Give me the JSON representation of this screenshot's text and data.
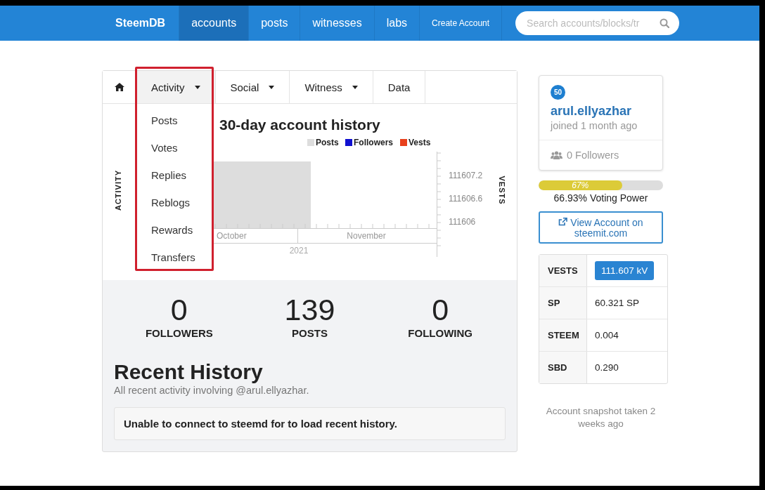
{
  "nav": {
    "brand": "SteemDB",
    "items": [
      {
        "label": "accounts",
        "kind": "link",
        "selected": true
      },
      {
        "label": "posts",
        "kind": "link",
        "selected": false
      },
      {
        "label": "witnesses",
        "kind": "link",
        "selected": false
      },
      {
        "label": "labs",
        "kind": "link",
        "selected": false
      },
      {
        "label": "Create Account",
        "kind": "small",
        "selected": false
      }
    ],
    "search": {
      "placeholder": "Search accounts/blocks/tr"
    }
  },
  "tabs": [
    {
      "kind": "home",
      "selected": false
    },
    {
      "kind": "dropdown",
      "label": "Activity",
      "selected": true
    },
    {
      "kind": "dropdown",
      "label": "Social",
      "selected": false
    },
    {
      "kind": "dropdown",
      "label": "Witness",
      "selected": false
    },
    {
      "kind": "plain",
      "label": "Data",
      "selected": false
    }
  ],
  "activity_menu": [
    "Posts",
    "Votes",
    "Replies",
    "Reblogs",
    "Rewards",
    "Transfers"
  ],
  "chart": {
    "title": "30-day account history",
    "legend": [
      {
        "label": "Posts",
        "color": "#dddddd"
      },
      {
        "label": "Followers",
        "color": "#1010d0"
      },
      {
        "label": "Vests",
        "color": "#e8401c"
      }
    ],
    "left_axis_label": "ACTIVITY",
    "right_axis_label": "VESTS",
    "right_ticks": [
      "111607.2",
      "111606.6",
      "111606"
    ],
    "x_labels": [
      "October",
      "November"
    ],
    "year_label": "2021"
  },
  "stats": [
    {
      "value": "0",
      "label": "FOLLOWERS"
    },
    {
      "value": "139",
      "label": "POSTS"
    },
    {
      "value": "0",
      "label": "FOLLOWING"
    }
  ],
  "recent": {
    "title": "Recent History",
    "subtitle": "All recent activity involving @arul.ellyazhar.",
    "notice": "Unable to connect to steemd for to load recent history."
  },
  "profile": {
    "reputation": "50",
    "name": "arul.ellyazhar",
    "joined": "joined 1 month ago",
    "followers": "0 Followers"
  },
  "voting": {
    "level": 0.67,
    "reading": "67%",
    "caption": "66.93% Voting Power"
  },
  "view_button": "View Account on steemit.com",
  "balances": [
    {
      "label": "VESTS",
      "value": "111.607 kV",
      "kind": "badge"
    },
    {
      "label": "SP",
      "value": "60.321 SP",
      "kind": "plain"
    },
    {
      "label": "STEEM",
      "value": "0.004",
      "kind": "plain"
    },
    {
      "label": "SBD",
      "value": "0.290",
      "kind": "plain"
    }
  ],
  "snapshot": "Account snapshot taken 2 weeks ago"
}
